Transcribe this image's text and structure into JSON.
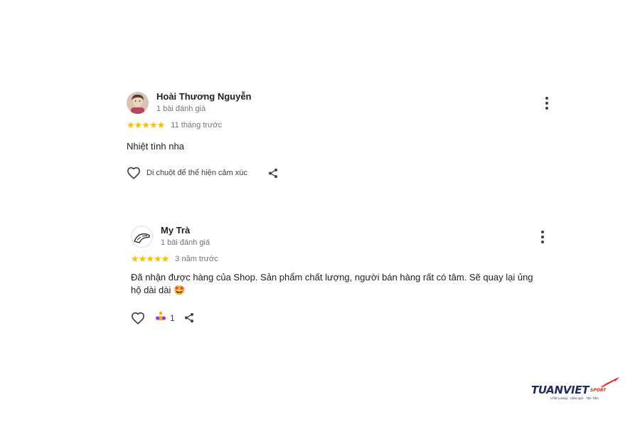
{
  "reviews": [
    {
      "author": "Hoài Thương Nguyễn",
      "review_count": "1 bài đánh giá",
      "stars": "★★★★★",
      "rating": 5,
      "time": "11 tháng trước",
      "text": "Nhiệt tình nha",
      "like_hint": "Di chuột để thể hiện cảm xúc",
      "icons": {
        "like": "heart-outline-icon",
        "share": "share-icon",
        "more": "more-vert-icon"
      }
    },
    {
      "author": "My Trà",
      "review_count": "1 bài đánh giá",
      "stars": "★★★★★",
      "rating": 5,
      "time": "3 năm trước",
      "text": "Đã nhận được hàng của Shop. Sản phẩm chất lượng, người bán hàng rất có tâm. Sẽ quay lại ủng hộ dài dài 🤩",
      "reaction_count": "1",
      "icons": {
        "like": "heart-outline-icon",
        "reaction": "thank-you-reaction-icon",
        "share": "share-icon",
        "more": "more-vert-icon"
      }
    }
  ],
  "logo": {
    "name": "TUANVIET",
    "suffix": "SPORT",
    "tagline": "Chất Lượng - Hiệu quả - Tận Tâm"
  },
  "colors": {
    "star": "#fbbc04",
    "text": "#202124",
    "secondary": "#70757a",
    "logo_navy": "#1f2d5c",
    "logo_red": "#e1251b"
  }
}
